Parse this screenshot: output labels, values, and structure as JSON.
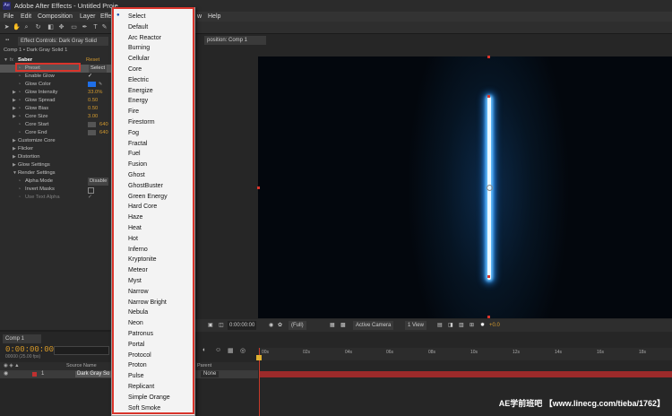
{
  "titlebar": {
    "logo": "Ae",
    "title": "Adobe After Effects - Untitled Proje"
  },
  "menu": [
    "File",
    "Edit",
    "Composition",
    "Layer",
    "Effe",
    "w",
    "Help"
  ],
  "left_panel": {
    "tab_label": "Effect Controls: Dark Gray Solid",
    "breadcrumb": "Comp 1 • Dark Gray Solid 1",
    "effect_name": "Saber",
    "reset_label": "Reset",
    "rows": [
      {
        "label": "Preset",
        "value": "Select"
      },
      {
        "label": "Enable Glow",
        "value": "✓"
      },
      {
        "label": "Glow Color",
        "value": ""
      },
      {
        "label": "Glow Intensity",
        "value": "33.0%"
      },
      {
        "label": "Glow Spread",
        "value": "0.50"
      },
      {
        "label": "Glow Bias",
        "value": "0.50"
      },
      {
        "label": "Core Size",
        "value": "3.00"
      },
      {
        "label": "Core Start",
        "value": "640"
      },
      {
        "label": "Core End",
        "value": "640"
      },
      {
        "label": "Customize Core",
        "value": ""
      },
      {
        "label": "Flicker",
        "value": ""
      },
      {
        "label": "Distortion",
        "value": ""
      },
      {
        "label": "Glow Settings",
        "value": ""
      },
      {
        "label": "Render Settings",
        "value": ""
      },
      {
        "label": "Alpha Mode",
        "value": "Disable"
      },
      {
        "label": "Invert Masks",
        "value": ""
      },
      {
        "label": "Use Text Alpha",
        "value": "✓"
      }
    ]
  },
  "comp_panel": {
    "tab_label": "position: Comp 1"
  },
  "viewer_bar": {
    "timecode": "0:00:00:00",
    "resolution": "(Full)",
    "camera": "Active Camera",
    "views": "1 View",
    "exposure": "+0.0"
  },
  "timeline": {
    "tab_label": "Comp 1",
    "timecode": "0:00:00:00",
    "fps": "00000 (25.00 fps)",
    "ticks": [
      "00s",
      "02s",
      "04s",
      "06s",
      "08s",
      "10s",
      "12s",
      "14s",
      "16s",
      "18s"
    ],
    "col_source": "Source Name",
    "col_parent": "Parent",
    "layer_number": "1",
    "layer_name": "Dark Gray So",
    "layer_parent": "None"
  },
  "dropdown": {
    "items": [
      "Select",
      "Default",
      "Arc Reactor",
      "Burning",
      "Cellular",
      "Core",
      "Electric",
      "Energize",
      "Energy",
      "Fire",
      "Firestorm",
      "Fog",
      "Fractal",
      "Fuel",
      "Fusion",
      "Ghost",
      "GhostBuster",
      "Green Energy",
      "Hard Core",
      "Haze",
      "Heat",
      "Hot",
      "Inferno",
      "Kryptonite",
      "Meteor",
      "Myst",
      "Narrow",
      "Narrow Bright",
      "Nebula",
      "Neon",
      "Patronus",
      "Portal",
      "Protocol",
      "Proton",
      "Pulse",
      "Replicant",
      "Simple Orange",
      "Soft Smoke"
    ],
    "selected": "Select"
  },
  "watermark": "AE学前班吧 【www.linecg.com/tieba/1762】",
  "colors": {
    "accent": "#d9342b",
    "value_orange": "#d39a2e",
    "glow_color": "#1f6fe8"
  }
}
